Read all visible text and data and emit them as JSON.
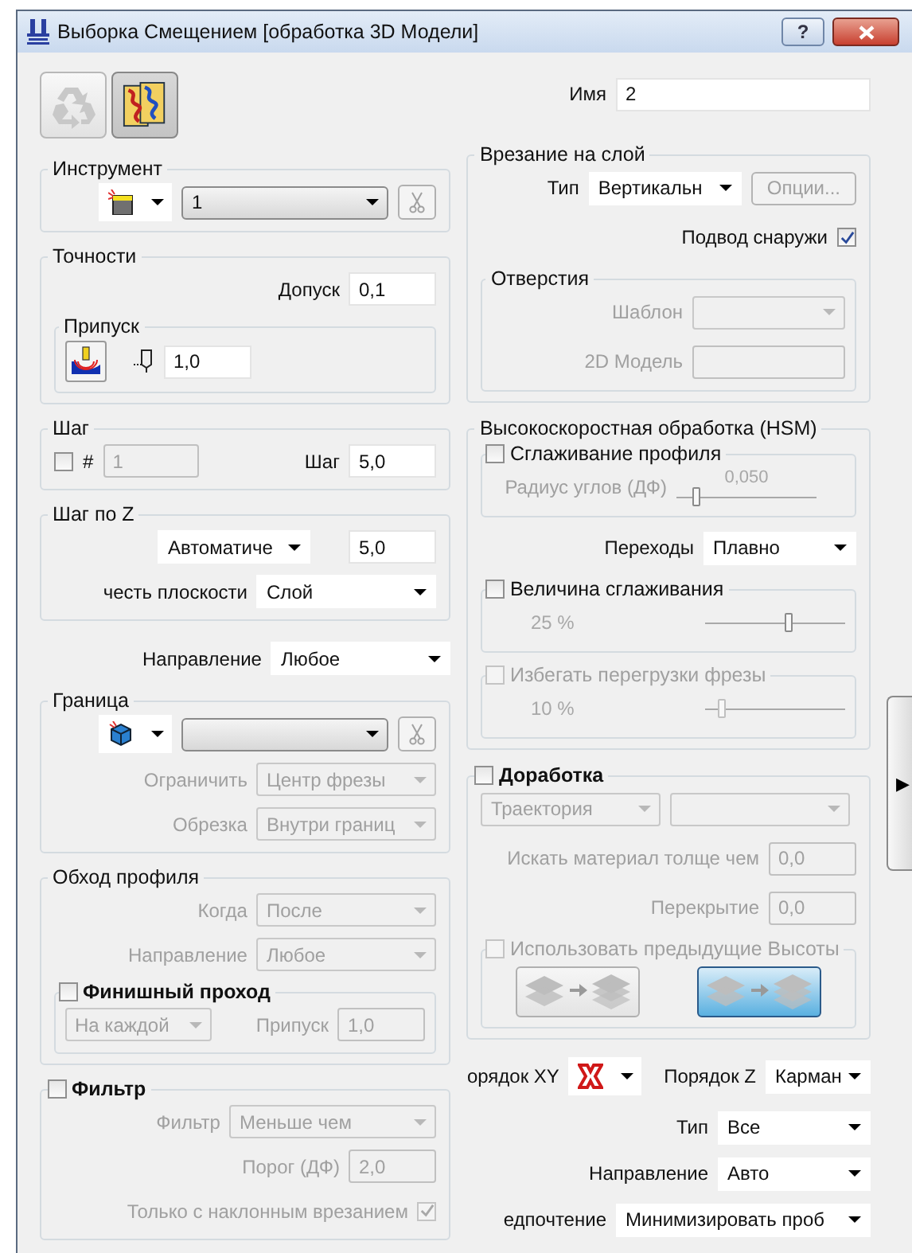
{
  "window": {
    "title": "Выборка Смещением [обработка 3D Модели]",
    "help": "?"
  },
  "toolbar": [
    {
      "kind": "recycle",
      "selected": false,
      "disabled": true
    },
    {
      "kind": "pattern",
      "selected": true,
      "disabled": false
    }
  ],
  "name": {
    "label": "Имя",
    "value": "2",
    "kind": "input",
    "disabled": false
  },
  "tool": {
    "title": "Инструмент",
    "value": "1",
    "kind": "combo",
    "disabled": false,
    "cut_disabled": true
  },
  "tolerances": {
    "title": "Точности",
    "tolerance": {
      "label": "Допуск",
      "value": "0,1",
      "kind": "input",
      "disabled": false
    },
    "allowance_title": "Припуск",
    "allowance": {
      "value": "1,0",
      "kind": "input",
      "disabled": false
    }
  },
  "stepover": {
    "title": "Шаг",
    "count_checked": false,
    "count_label": "#",
    "count": {
      "value": "1",
      "kind": "input",
      "disabled": true
    },
    "step": {
      "label": "Шаг",
      "value": "5,0",
      "kind": "input",
      "disabled": false
    }
  },
  "stepdown": {
    "title": "Шаг по Z",
    "mode": {
      "value": "Автоматиче",
      "kind": "dropdown",
      "disabled": false
    },
    "value": {
      "value": "5,0",
      "kind": "input",
      "disabled": false
    },
    "flats": {
      "label": "честь плоскости",
      "value": "Слой",
      "kind": "dropdown",
      "disabled": false
    }
  },
  "direction": {
    "label": "Направление",
    "value": "Любое",
    "kind": "dropdown",
    "disabled": false
  },
  "boundary": {
    "title": "Граница",
    "select": {
      "kind": "combo",
      "disabled": false
    },
    "cut_disabled": true,
    "fields": [
      {
        "label": "Ограничить",
        "value": "Центр фрезы",
        "kind": "dropdown",
        "disabled": true
      },
      {
        "label": "Обрезка",
        "value": "Внутри границ",
        "kind": "dropdown",
        "disabled": true
      }
    ]
  },
  "profile": {
    "title": "Обход профиля",
    "fields": [
      {
        "label": "Когда",
        "value": "После",
        "kind": "dropdown",
        "disabled": true
      },
      {
        "label": "Направление",
        "value": "Любое",
        "kind": "dropdown",
        "disabled": true
      }
    ],
    "finish": {
      "label": "Финишный проход",
      "checked": false,
      "fields": [
        {
          "value": "На каждой",
          "kind": "dropdown",
          "disabled": true
        },
        {
          "label": "Припуск",
          "value": "1,0",
          "kind": "input",
          "disabled": true
        }
      ]
    }
  },
  "filter": {
    "label": "Фильтр",
    "checked": false,
    "fields": [
      {
        "label": "Фильтр",
        "value": "Меньше чем",
        "kind": "dropdown",
        "disabled": true
      },
      {
        "label": "Порог (ДФ)",
        "value": "2,0",
        "kind": "input",
        "disabled": true
      }
    ],
    "ramp": {
      "label": "Только с наклонным врезанием",
      "checked": true,
      "disabled": true
    }
  },
  "lead_in": {
    "title": "Врезание на слой",
    "type": {
      "label": "Тип",
      "value": "Вертикальн",
      "kind": "dropdown",
      "disabled": false
    },
    "options": {
      "label": "Опции...",
      "disabled": true
    },
    "outside": {
      "label": "Подвод снаружи",
      "checked": true,
      "disabled": false
    },
    "holes": {
      "title": "Отверстия",
      "fields": [
        {
          "label": "Шаблон",
          "kind": "dropdown",
          "disabled": true
        },
        {
          "label": "2D Модель",
          "kind": "input",
          "disabled": true
        }
      ]
    }
  },
  "hsm": {
    "title": "Высокоскоростная обработка (HSM)",
    "profile_smoothing": {
      "label": "Сглаживание профиля",
      "checked": false,
      "disabled": false,
      "slider_label": "Радиус углов (ДФ)",
      "reading": "0,050",
      "level": 0.15
    },
    "transitions": {
      "label": "Переходы",
      "value": "Плавно",
      "kind": "dropdown",
      "disabled": false
    },
    "smoothing": {
      "label": "Величина сглаживания",
      "checked": false,
      "disabled": false,
      "reading": "25 %",
      "level": 0.6
    },
    "overload": {
      "label": "Избегать перегрузки фрезы",
      "checked": false,
      "disabled": true,
      "reading": "10 %",
      "level": 0.12
    }
  },
  "rest": {
    "label": "Доработка",
    "checked": false,
    "selects": [
      {
        "value": "Траектория",
        "kind": "dropdown",
        "disabled": true
      },
      {
        "kind": "dropdown",
        "disabled": true
      }
    ],
    "fields": [
      {
        "label": "Искать материал толще чем",
        "value": "0,0",
        "kind": "input",
        "disabled": true
      },
      {
        "label": "Перекрытие",
        "value": "0,0",
        "kind": "input",
        "disabled": true
      }
    ],
    "use_previous": {
      "label": "Использовать предыдущие Высоты",
      "checked": false,
      "disabled": true,
      "options": [
        {
          "selected": false
        },
        {
          "selected": true
        }
      ]
    }
  },
  "order": {
    "xy_label": "орядок XY",
    "z": {
      "label": "Порядок Z",
      "value": "Карман",
      "kind": "dropdown",
      "disabled": false
    },
    "fields": [
      {
        "label": "Тип",
        "value": "Все",
        "kind": "dropdown",
        "disabled": false
      },
      {
        "label": "Направление",
        "value": "Авто",
        "kind": "dropdown",
        "disabled": false
      },
      {
        "label": "едпочтение",
        "value": "Минимизировать проб",
        "kind": "dropdown",
        "disabled": false
      }
    ]
  },
  "side_tab": {
    "arrow": "▶"
  }
}
